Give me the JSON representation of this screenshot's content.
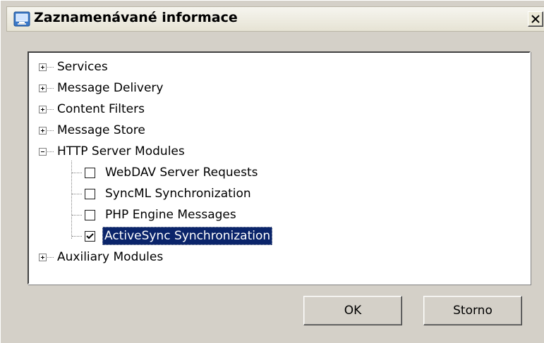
{
  "dialog": {
    "title": "Zaznamenávané informace",
    "close_icon": "close-x-icon",
    "app_icon": "monitor-icon"
  },
  "tree": {
    "items": [
      {
        "label": "Services",
        "expander": "plus",
        "level": 0
      },
      {
        "label": "Message Delivery",
        "expander": "plus",
        "level": 0
      },
      {
        "label": "Content Filters",
        "expander": "plus",
        "level": 0
      },
      {
        "label": "Message Store",
        "expander": "plus",
        "level": 0
      },
      {
        "label": "HTTP Server Modules",
        "expander": "minus",
        "level": 0
      },
      {
        "label": "WebDAV Server Requests",
        "checked": false,
        "level": 1
      },
      {
        "label": "SyncML Synchronization",
        "checked": false,
        "level": 1
      },
      {
        "label": "PHP Engine Messages",
        "checked": false,
        "level": 1
      },
      {
        "label": "ActiveSync Synchronization",
        "checked": true,
        "selected": true,
        "level": 1
      },
      {
        "label": "Auxiliary Modules",
        "expander": "plus",
        "level": 0
      }
    ]
  },
  "buttons": {
    "ok_label": "OK",
    "cancel_label": "Storno"
  },
  "colors": {
    "selection_bg": "#0a246a",
    "selection_fg": "#ffffff",
    "dialog_bg": "#d4d0c8"
  }
}
